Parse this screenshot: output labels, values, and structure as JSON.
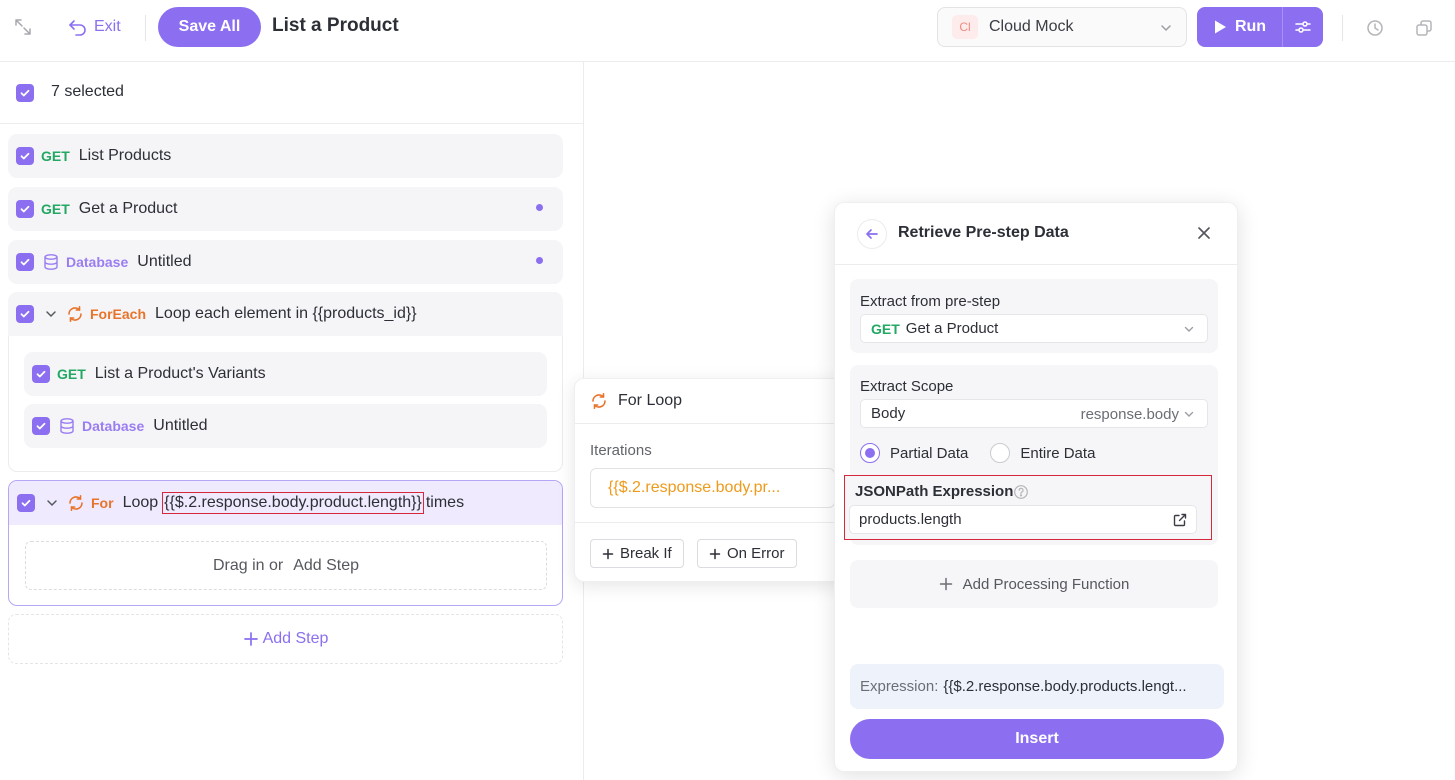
{
  "header": {
    "exit_label": "Exit",
    "save_all_label": "Save All",
    "title": "List a Product",
    "env_badge": "Cl",
    "env_name": "Cloud Mock",
    "run_label": "Run"
  },
  "selection": {
    "count_label": "7 selected"
  },
  "steps": [
    {
      "method": "GET",
      "name": "List Products"
    },
    {
      "method": "GET",
      "name": "Get a Product"
    },
    {
      "method": "Database",
      "name": "Untitled"
    },
    {
      "method": "ForEach",
      "name": "Loop each element in {{products_id}}"
    },
    {
      "method": "GET",
      "name": "List a Product's Variants"
    },
    {
      "method": "Database",
      "name": "Untitled"
    }
  ],
  "for_step": {
    "method": "For",
    "prefix": "Loop",
    "expression": "{{$.2.response.body.product.length}}",
    "suffix": "times",
    "drop_text": "Drag in or",
    "drop_add": "Add Step"
  },
  "add_step_label": "Add Step",
  "for_loop_popover": {
    "title": "For Loop",
    "iterations_label": "Iterations",
    "iterations_value": "{{$.2.response.body.pr...",
    "break_if_label": "Break If",
    "on_error_label": "On Error"
  },
  "retrieve_panel": {
    "title": "Retrieve Pre-step Data",
    "extract_from_label": "Extract from pre-step",
    "extract_from_method": "GET",
    "extract_from_value": "Get a Product",
    "scope_label": "Extract Scope",
    "scope_value": "Body",
    "scope_path": "response.body",
    "partial_label": "Partial Data",
    "entire_label": "Entire Data",
    "jsonpath_label": "JSONPath Expression",
    "jsonpath_value": "products.length",
    "add_processing_label": "Add Processing Function",
    "expression_label": "Expression:",
    "expression_value": "{{$.2.response.body.products.lengt...",
    "insert_label": "Insert"
  },
  "colors": {
    "accent": "#8b6ff0",
    "get": "#23a863",
    "loop": "#e8742c",
    "highlight_border": "#d6283a"
  }
}
